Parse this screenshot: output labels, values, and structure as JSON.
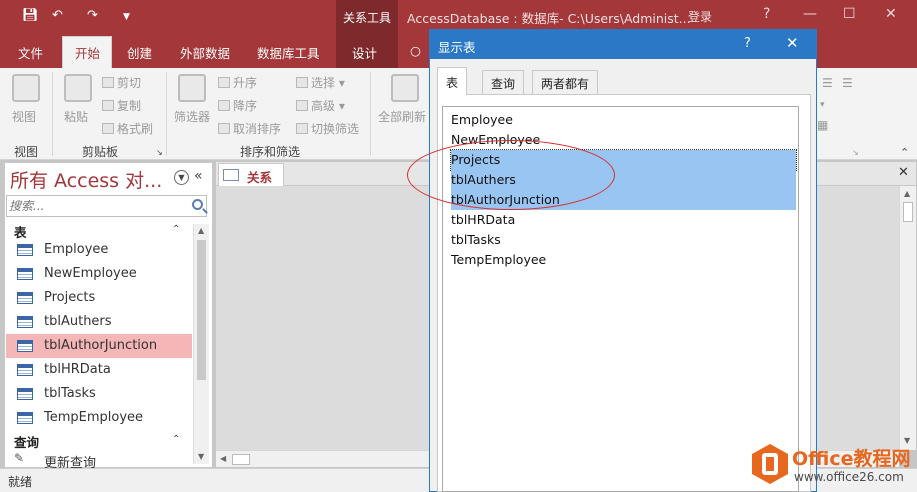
{
  "titlebar": {
    "save_icon": "save-icon",
    "undo_icon": "undo-icon",
    "redo_icon": "redo-icon",
    "customize_icon": "customize-dropdown-icon",
    "context_label": "关系工具",
    "window_title": "AccessDatabase : 数据库- C:\\Users\\Administ...",
    "login": "登录",
    "controls": [
      "?",
      "—",
      "☐",
      "✕"
    ],
    "accent": "#a4373a"
  },
  "ribbon_tabs": [
    "文件",
    "开始",
    "创建",
    "外部数据",
    "数据库工具",
    "设计"
  ],
  "ribbon": {
    "view": "视图",
    "paste": "粘贴",
    "cut": "剪切",
    "copy": "复制",
    "format_painter": "格式刷",
    "filter": "筛选器",
    "ascending": "升序",
    "descending": "降序",
    "remove_sort": "取消排序",
    "selection": "选择",
    "advanced": "高级",
    "toggle_filter": "切换筛选",
    "refresh_all": "全部刷新",
    "groups": {
      "views": "视图",
      "clipboard": "剪贴板",
      "sort_filter": "排序和筛选"
    }
  },
  "nav": {
    "title": "所有 Access 对...",
    "search_placeholder": "搜索...",
    "section_tables": "表",
    "tables": [
      "Employee",
      "NewEmployee",
      "Projects",
      "tblAuthers",
      "tblAuthorJunction",
      "tblHRData",
      "tblTasks",
      "TempEmployee"
    ],
    "selected_index": 4,
    "section_queries": "查询",
    "queries": [
      "更新查询"
    ]
  },
  "doc_tab": {
    "label": "关系"
  },
  "dialog": {
    "title": "显示表",
    "help": "?",
    "close": "✕",
    "tabs": [
      "表",
      "查询",
      "两者都有"
    ],
    "active_tab": 0,
    "items": [
      "Employee",
      "NewEmployee",
      "Projects",
      "tblAuthers",
      "tblAuthorJunction",
      "tblHRData",
      "tblTasks",
      "TempEmployee"
    ],
    "selected_indices": [
      2,
      3,
      4
    ],
    "selection_color": "#99c5f3"
  },
  "statusbar": {
    "text": "就绪"
  },
  "watermark": {
    "name": "Office教程网",
    "url": "www.office26.com",
    "color": "#e8671e"
  }
}
